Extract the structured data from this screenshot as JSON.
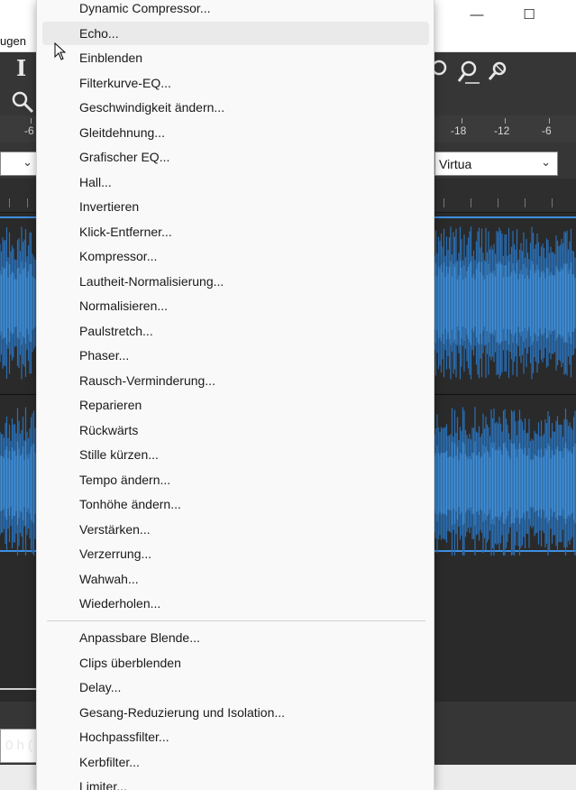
{
  "window": {
    "minimize_glyph": "—",
    "maximize_glyph": "☐"
  },
  "menubar": {
    "partial_label": "ugen"
  },
  "toolbar": {
    "meter_ticks_left": [
      "-6"
    ],
    "meter_ticks_right": [
      "-18",
      "-12",
      "-6"
    ],
    "device_dropdown_value": "Virtua",
    "time_fragment": "0 h ("
  },
  "effects_menu": {
    "items_top": [
      {
        "label": "Dynamic Compressor..."
      },
      {
        "label": "Echo..."
      },
      {
        "label": "Einblenden"
      },
      {
        "label": "Filterkurve-EQ..."
      },
      {
        "label": "Geschwindigkeit ändern..."
      },
      {
        "label": "Gleitdehnung..."
      },
      {
        "label": "Grafischer EQ..."
      },
      {
        "label": "Hall..."
      },
      {
        "label": "Invertieren"
      },
      {
        "label": "Klick-Entferner..."
      },
      {
        "label": "Kompressor..."
      },
      {
        "label": "Lautheit-Normalisierung..."
      },
      {
        "label": "Normalisieren..."
      },
      {
        "label": "Paulstretch..."
      },
      {
        "label": "Phaser..."
      },
      {
        "label": "Rausch-Verminderung..."
      },
      {
        "label": "Reparieren"
      },
      {
        "label": "Rückwärts"
      },
      {
        "label": "Stille kürzen..."
      },
      {
        "label": "Tempo ändern..."
      },
      {
        "label": "Tonhöhe ändern..."
      },
      {
        "label": "Verstärken..."
      },
      {
        "label": "Verzerrung..."
      },
      {
        "label": "Wahwah..."
      },
      {
        "label": "Wiederholen..."
      }
    ],
    "items_bottom": [
      {
        "label": "Anpassbare Blende..."
      },
      {
        "label": "Clips überblenden"
      },
      {
        "label": "Delay..."
      },
      {
        "label": "Gesang-Reduzierung und Isolation..."
      },
      {
        "label": "Hochpassfilter..."
      },
      {
        "label": "Kerbfilter..."
      },
      {
        "label": "Limiter..."
      }
    ],
    "hovered_item": "Echo..."
  },
  "colors": {
    "waveform": "#3d8fdc",
    "waveform_dark": "#2a6fb4",
    "selection_line": "#3f8fe0",
    "menu_bg": "#f9f9f9",
    "hover_bg": "#eaeaea"
  }
}
